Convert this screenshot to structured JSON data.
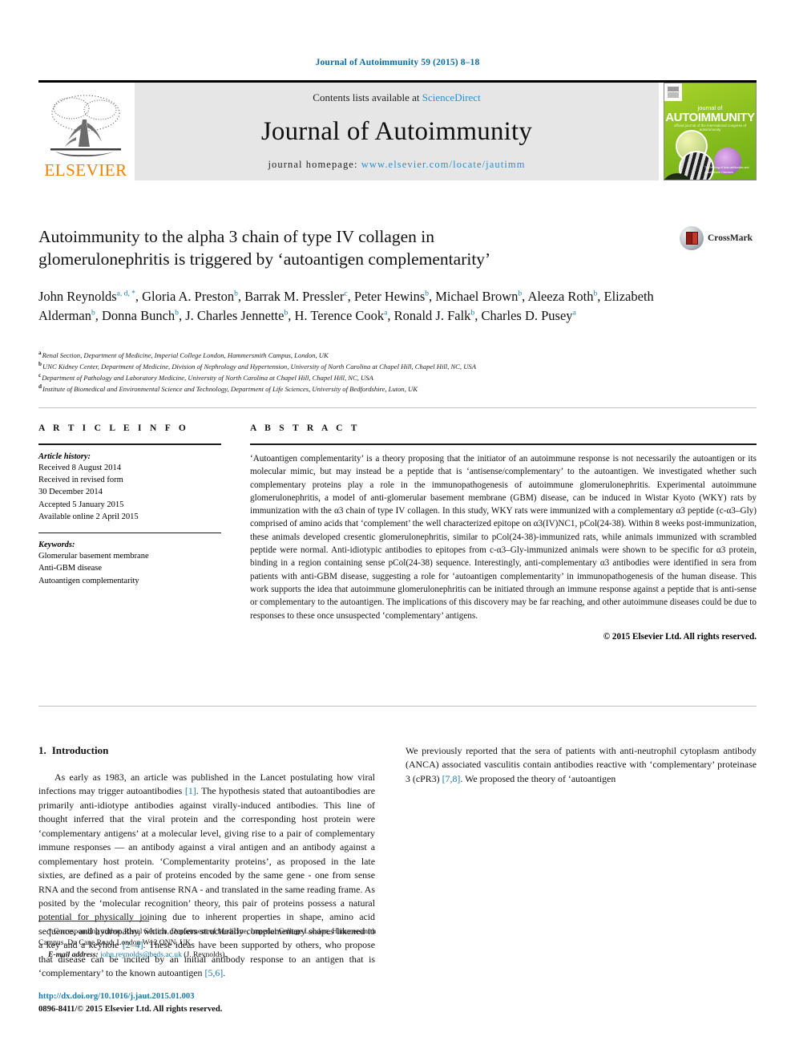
{
  "running_head": "Journal of Autoimmunity 59 (2015) 8–18",
  "masthead": {
    "contents_prefix": "Contents lists available at",
    "sciencedirect": "ScienceDirect",
    "journal_name": "Journal of Autoimmunity",
    "homepage_prefix": "journal homepage:",
    "homepage_url": "www.elsevier.com/locate/jautimm",
    "publisher_wordmark": "ELSEVIER",
    "cover": {
      "journal_of": "journal of",
      "title": "AUTOIMMUNITY",
      "subtitle": "official journal of the international congress of autoimmunity",
      "caption": "The Making of Auto-antibodies and Autoimmune Diseases"
    }
  },
  "crossmark": {
    "label": "CrossMark"
  },
  "article": {
    "title": "Autoimmunity to the alpha 3 chain of type IV collagen in glomerulonephritis is triggered by ‘autoantigen complementarity’",
    "authors_lines": [
      "John Reynolds a, d, *, Gloria A. Preston b, Barrak M. Pressler c, Peter Hewins b,",
      "Michael Brown b, Aleeza Roth b, Elizabeth Alderman b, Donna Bunch b,",
      "J. Charles Jennette b, H. Terence Cook a, Ronald J. Falk b, Charles D. Pusey a"
    ],
    "authors": [
      {
        "name": "John Reynolds",
        "marks": "a, d, *"
      },
      {
        "name": "Gloria A. Preston",
        "marks": "b"
      },
      {
        "name": "Barrak M. Pressler",
        "marks": "c"
      },
      {
        "name": "Peter Hewins",
        "marks": "b"
      },
      {
        "name": "Michael Brown",
        "marks": "b"
      },
      {
        "name": "Aleeza Roth",
        "marks": "b"
      },
      {
        "name": "Elizabeth Alderman",
        "marks": "b"
      },
      {
        "name": "Donna Bunch",
        "marks": "b"
      },
      {
        "name": "J. Charles Jennette",
        "marks": "b"
      },
      {
        "name": "H. Terence Cook",
        "marks": "a"
      },
      {
        "name": "Ronald J. Falk",
        "marks": "b"
      },
      {
        "name": "Charles D. Pusey",
        "marks": "a"
      }
    ],
    "affiliations": [
      {
        "mark": "a",
        "text": "Renal Section, Department of Medicine, Imperial College London, Hammersmith Campus, London, UK"
      },
      {
        "mark": "b",
        "text": "UNC Kidney Center, Department of Medicine, Division of Nephrology and Hypertension, University of North Carolina at Chapel Hill, Chapel Hill, NC, USA"
      },
      {
        "mark": "c",
        "text": "Department of Pathology and Laboratory Medicine, University of North Carolina at Chapel Hill, Chapel Hill, NC, USA"
      },
      {
        "mark": "d",
        "text": "Institute of Biomedical and Environmental Science and Technology, Department of Life Sciences, University of Bedfordshire, Luton, UK"
      }
    ]
  },
  "article_info": {
    "heading": "A R T I C L E   I N F O",
    "history_label": "Article history:",
    "history": [
      "Received 8 August 2014",
      "Received in revised form",
      "30 December 2014",
      "Accepted 5 January 2015",
      "Available online 2 April 2015"
    ],
    "keywords_label": "Keywords:",
    "keywords": [
      "Glomerular basement membrane",
      "Anti-GBM disease",
      "Autoantigen complementarity"
    ]
  },
  "abstract": {
    "heading": "A B S T R A C T",
    "text": "‘Autoantigen complementarity’ is a theory proposing that the initiator of an autoimmune response is not necessarily the autoantigen or its molecular mimic, but may instead be a peptide that is ‘antisense/complementary’ to the autoantigen. We investigated whether such complementary proteins play a role in the immunopathogenesis of autoimmune glomerulonephritis. Experimental autoimmune glomerulonephritis, a model of anti-glomerular basement membrane (GBM) disease, can be induced in Wistar Kyoto (WKY) rats by immunization with the α3 chain of type IV collagen. In this study, WKY rats were immunized with a complementary α3 peptide (c-α3–Gly) comprised of amino acids that ‘complement’ the well characterized epitope on α3(IV)NC1, pCol(24-38). Within 8 weeks post-immunization, these animals developed cresentic glomerulonephritis, similar to pCol(24-38)-immunized rats, while animals immunized with scrambled peptide were normal. Anti-idiotypic antibodies to epitopes from c-α3–Gly-immunized animals were shown to be specific for α3 protein, binding in a region containing sense pCol(24-38) sequence. Interestingly, anti-complementary α3 antibodies were identified in sera from patients with anti-GBM disease, suggesting a role for ‘autoantigen complementarity’ in immunopathogenesis of the human disease. This work supports the idea that autoimmune glomerulonephritis can be initiated through an immune response against a peptide that is anti-sense or complementary to the autoantigen. The implications of this discovery may be far reaching, and other autoimmune diseases could be due to responses to these once unsuspected ‘complementary’ antigens.",
    "copyright": "© 2015 Elsevier Ltd. All rights reserved."
  },
  "introduction": {
    "number": "1.",
    "title": "Introduction",
    "left_paragraph_1_part1": "As early as 1983, an article was published in the Lancet postulating how viral infections may trigger autoantibodies ",
    "left_ref_1": "[1]",
    "left_paragraph_1_part2": ". The hypothesis stated that autoantibodies are primarily anti-idiotype antibodies against virally-induced antibodies. This line of thought inferred that the viral protein and the corresponding host protein were ‘complementary antigens’ at a molecular level, giving rise to a pair of complementary immune responses — an antibody against a viral antigen and an antibody against a complementary host protein. ‘Complementarity proteins’, as proposed in the late sixties, are defined as a pair of proteins encoded by the same gene - one from sense RNA and the second from antisense RNA - and translated in the same reading frame. As posited by the ‘molecular recognition’ theory, this pair of proteins possess a natural potential for physically joining due to inherent properties in shape, amino acid sequence, and hydropathy, which confers structurally complementary shapes likened to a key and a keyhole ",
    "right_ref_2": "[2–4]",
    "right_paragraph_1_part3": ". These ideas have been supported by others, who propose that disease can be incited by an initial antibody response to an antigen that is ‘complementary’ to the known autoantigen ",
    "right_ref_3": "[5,6]",
    "right_paragraph_1_end": ".",
    "right_paragraph_2_part1": "We previously reported that the sera of patients with anti-neutrophil cytoplasm antibody (ANCA) associated vasculitis contain antibodies reactive with ‘complementary’ proteinase 3 (cPR3) ",
    "right_ref_4": "[7,8]",
    "right_paragraph_2_part2": ". We proposed the theory of ‘autoantigen"
  },
  "footnotes": {
    "corresponding_star": "*",
    "corresponding": " Corresponding author. Renal Section, Department of Medicine, Imperial College London, Hammersmith Campus, Du Cane Road, London W12 ONN, UK.",
    "email_label": "E-mail address:",
    "email": "john.reynolds@beds.ac.uk",
    "email_suffix": "(J. Reynolds).",
    "doi": "http://dx.doi.org/10.1016/j.jaut.2015.01.003",
    "issn_line": "0896-8411/© 2015 Elsevier Ltd. All rights reserved."
  },
  "colors": {
    "link": "#1878a8",
    "journal_header": "#0b6a9e",
    "elsevier_orange": "#f08000",
    "sciencedirect": "#2a8fcf"
  }
}
